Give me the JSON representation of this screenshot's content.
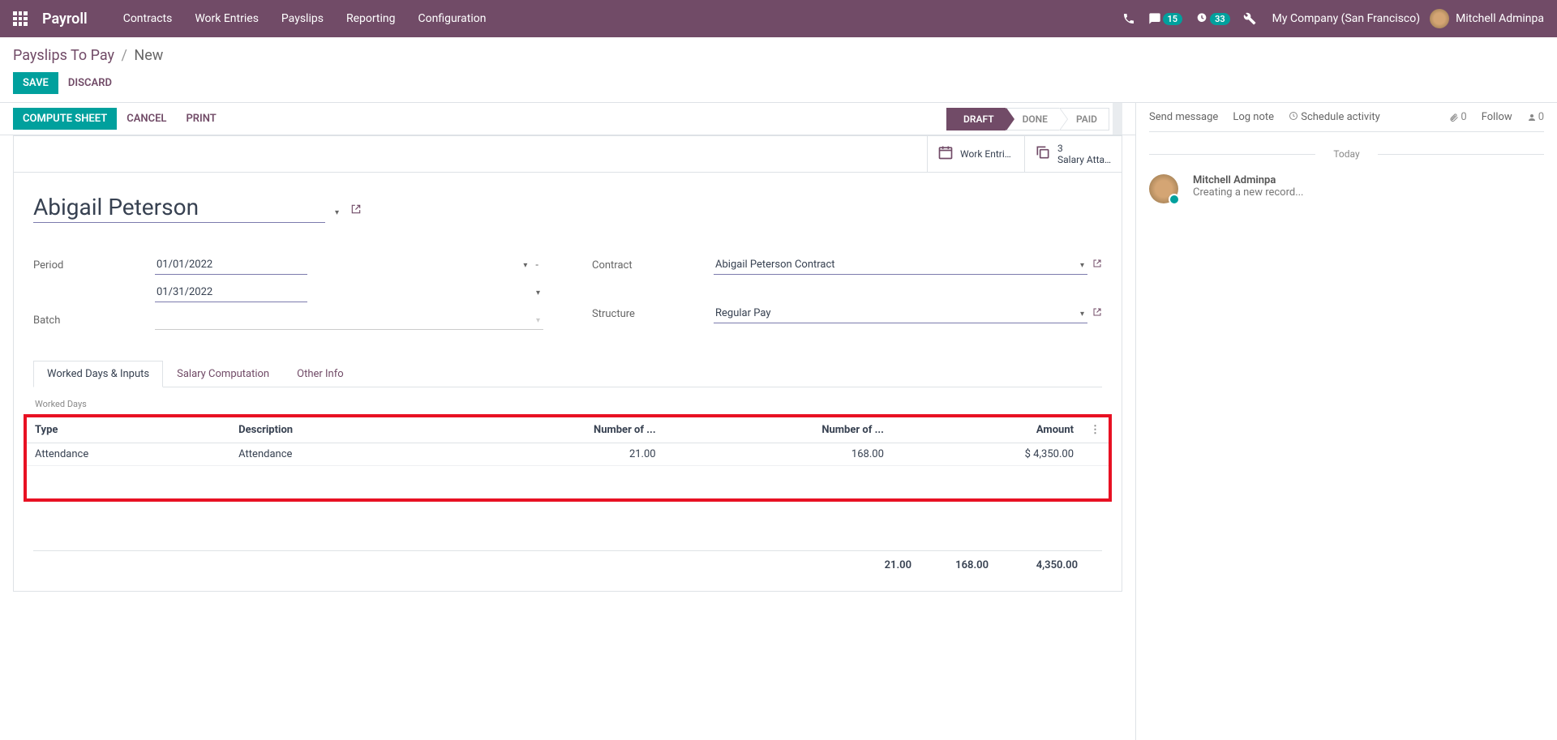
{
  "header": {
    "brand": "Payroll",
    "menu": [
      "Contracts",
      "Work Entries",
      "Payslips",
      "Reporting",
      "Configuration"
    ],
    "messages_badge": "15",
    "activities_badge": "33",
    "company": "My Company (San Francisco)",
    "user": "Mitchell Adminpa"
  },
  "breadcrumb": {
    "parent": "Payslips To Pay",
    "current": "New"
  },
  "actions": {
    "save": "SAVE",
    "discard": "DISCARD"
  },
  "toolbar": {
    "compute": "COMPUTE SHEET",
    "cancel": "CANCEL",
    "print": "PRINT",
    "stages": [
      "DRAFT",
      "DONE",
      "PAID"
    ],
    "active_stage": 0
  },
  "stat_buttons": {
    "work_entries": "Work Entries",
    "salary_atta_count": "3",
    "salary_atta_label": "Salary Atta..."
  },
  "form": {
    "employee": "Abigail Peterson",
    "period_label": "Period",
    "date_from": "01/01/2022",
    "date_to": "01/31/2022",
    "batch_label": "Batch",
    "batch": "",
    "contract_label": "Contract",
    "contract": "Abigail Peterson Contract",
    "structure_label": "Structure",
    "structure": "Regular Pay"
  },
  "tabs": [
    "Worked Days & Inputs",
    "Salary Computation",
    "Other Info"
  ],
  "worked_days": {
    "section": "Worked Days",
    "columns": [
      "Type",
      "Description",
      "Number of ...",
      "Number of ...",
      "Amount"
    ],
    "rows": [
      {
        "type": "Attendance",
        "desc": "Attendance",
        "days": "21.00",
        "hours": "168.00",
        "amount": "$ 4,350.00"
      }
    ],
    "totals": {
      "days": "21.00",
      "hours": "168.00",
      "amount": "4,350.00"
    }
  },
  "chatter": {
    "send": "Send message",
    "log": "Log note",
    "schedule": "Schedule activity",
    "attach_count": "0",
    "follow": "Follow",
    "followers": "0",
    "today": "Today",
    "msg_author": "Mitchell Adminpa",
    "msg_text": "Creating a new record..."
  }
}
